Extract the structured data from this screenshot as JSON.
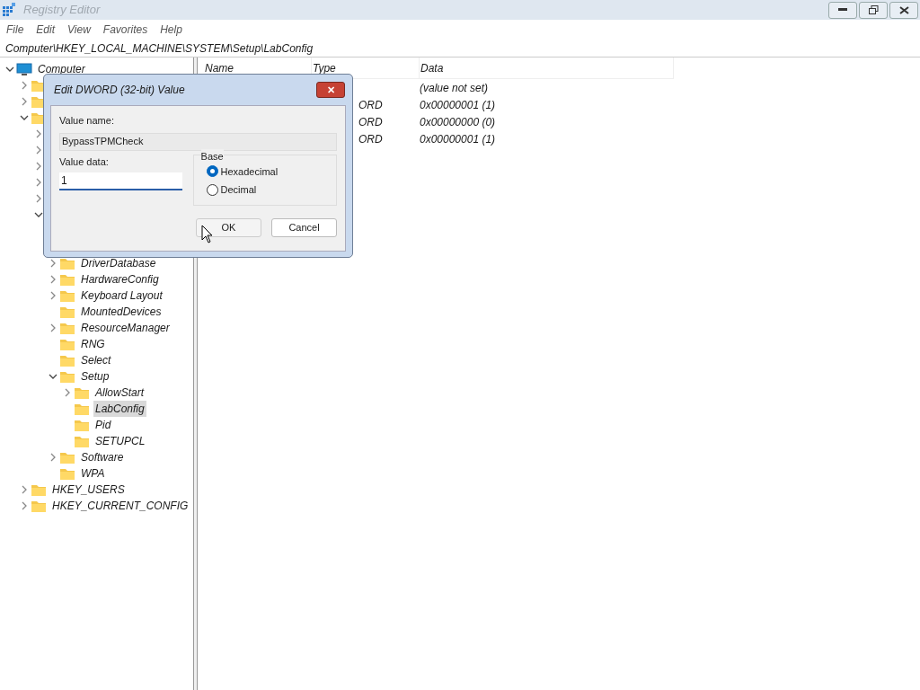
{
  "window": {
    "title": "Registry Editor"
  },
  "menu": [
    "File",
    "Edit",
    "View",
    "Favorites",
    "Help"
  ],
  "address": "Computer\\HKEY_LOCAL_MACHINE\\SYSTEM\\Setup\\LabConfig",
  "tree": [
    {
      "label": "Computer",
      "kind": "computer",
      "expanded": true,
      "selected": false,
      "children": [
        {
          "kind": "folder",
          "expanded": false
        },
        {
          "kind": "folder",
          "expanded": false
        },
        {
          "kind": "folder",
          "expanded": true,
          "children": [
            {
              "expanded": false
            },
            {
              "expanded": false
            },
            {
              "expanded": false
            },
            {
              "expanded": false
            },
            {
              "expanded": false
            },
            {
              "expanded": true,
              "children": [
                {
                  "label": "DriverDatabase",
                  "kind": "folder",
                  "expanded": false,
                  "selected": false
                },
                {
                  "label": "HardwareConfig",
                  "kind": "folder",
                  "expanded": false,
                  "selected": false
                },
                {
                  "label": "Keyboard Layout",
                  "kind": "folder",
                  "expanded": false,
                  "selected": false
                },
                {
                  "label": "MountedDevices",
                  "kind": "folder",
                  "selected": false
                },
                {
                  "label": "ResourceManager",
                  "kind": "folder",
                  "expanded": false,
                  "selected": false
                },
                {
                  "label": "RNG",
                  "kind": "folder",
                  "selected": false
                },
                {
                  "label": "Select",
                  "kind": "folder",
                  "selected": false
                },
                {
                  "label": "Setup",
                  "kind": "folder",
                  "expanded": true,
                  "selected": false,
                  "children": [
                    {
                      "label": "AllowStart",
                      "kind": "folder",
                      "expanded": false,
                      "selected": false
                    },
                    {
                      "label": "LabConfig",
                      "kind": "folder",
                      "selected": true
                    },
                    {
                      "label": "Pid",
                      "kind": "folder",
                      "selected": false
                    },
                    {
                      "label": "SETUPCL",
                      "kind": "folder",
                      "selected": false
                    }
                  ]
                },
                {
                  "label": "Software",
                  "kind": "folder",
                  "expanded": false,
                  "selected": false
                },
                {
                  "label": "WPA",
                  "kind": "folder",
                  "selected": false
                }
              ]
            }
          ]
        },
        {
          "label": "HKEY_USERS",
          "kind": "folder",
          "expanded": false,
          "selected": false
        },
        {
          "label": "HKEY_CURRENT_CONFIG",
          "kind": "folder",
          "expanded": false,
          "selected": false
        }
      ]
    }
  ],
  "table": {
    "columns": [
      "Name",
      "Type",
      "Data"
    ],
    "rows": [
      {
        "data": "(value not set)"
      },
      {
        "type": "ORD",
        "data": "0x00000001 (1)"
      },
      {
        "type": "ORD",
        "data": "0x00000000 (0)"
      },
      {
        "type": "ORD",
        "data": "0x00000001 (1)"
      }
    ]
  },
  "dialog": {
    "title": "Edit DWORD (32-bit) Value",
    "close": "✕",
    "name_label": "Value name:",
    "name_value": "BypassTPMCheck",
    "data_label": "Value data:",
    "data_value": "1",
    "base_label": "Base",
    "bases": [
      {
        "label": "Hexadecimal",
        "selected": true
      },
      {
        "label": "Decimal",
        "selected": false
      }
    ],
    "buttons": [
      "OK",
      "Cancel"
    ]
  }
}
